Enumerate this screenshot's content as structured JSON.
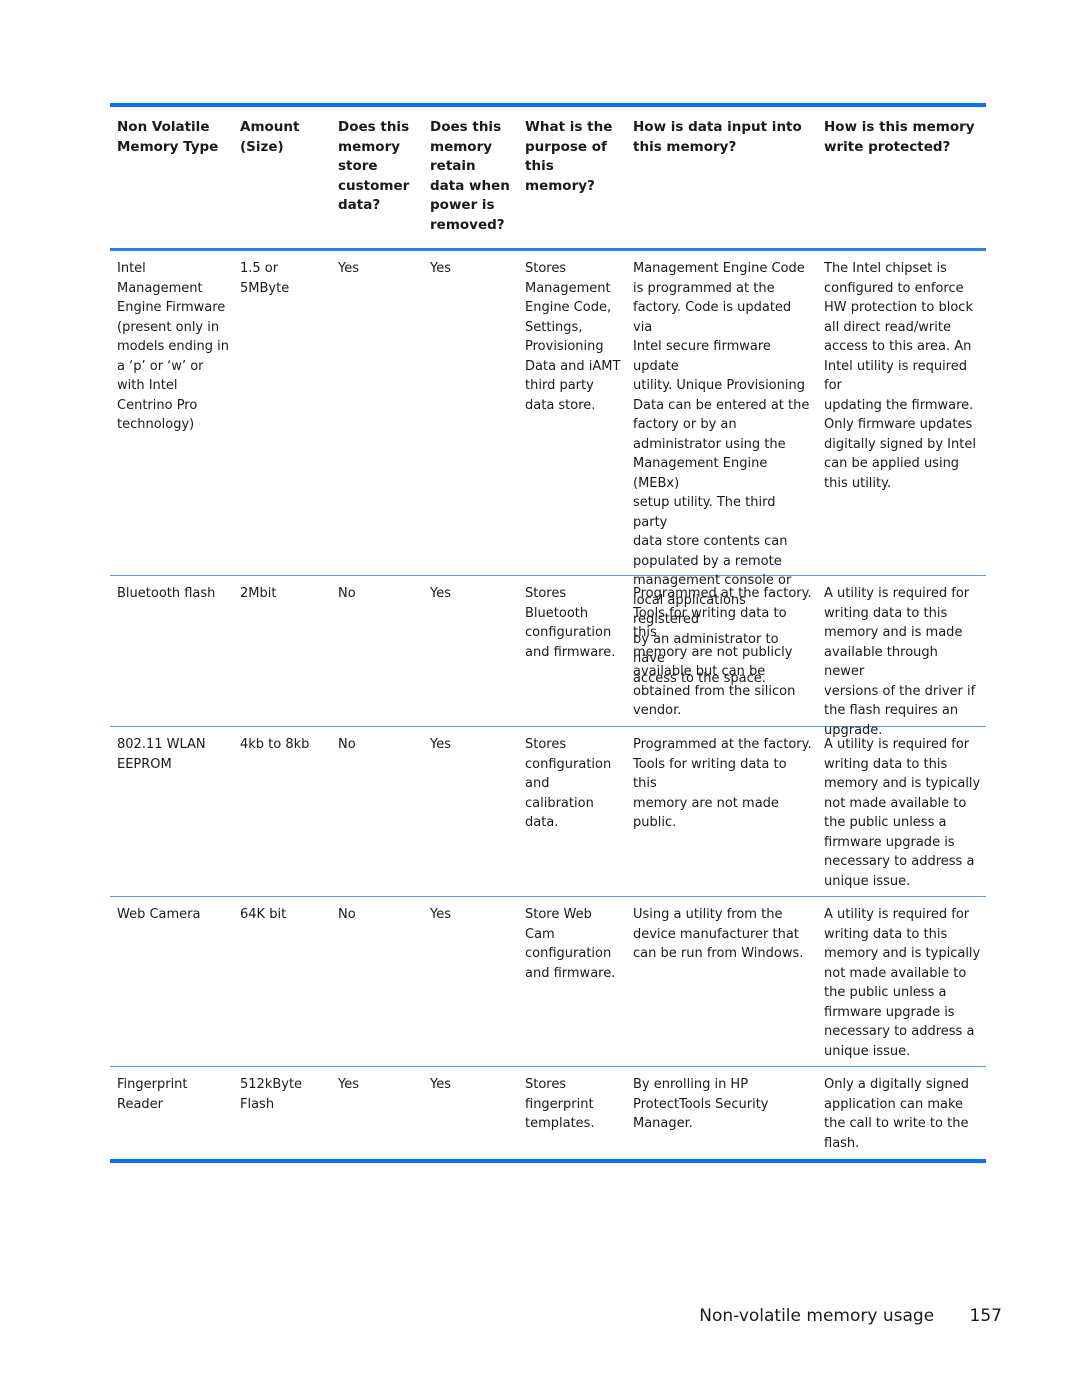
{
  "table": {
    "headers": [
      "Non Volatile\nMemory Type",
      "Amount\n(Size)",
      "Does this\nmemory\nstore\ncustomer\ndata?",
      "Does this\nmemory\nretain\ndata when\npower is\nremoved?",
      "What is the\npurpose of\nthis\nmemory?",
      "How is data input into\nthis memory?",
      "How is this memory\nwrite protected?"
    ],
    "rows": [
      {
        "type": "Intel\nManagement\nEngine Firmware\n(present only in\nmodels ending in\na ‘p’ or ‘w’ or\nwith Intel\nCentrino Pro\ntechnology)",
        "size": "1.5 or\n5MByte",
        "stores_customer_data": "Yes",
        "retains_data": "Yes",
        "purpose": "Stores\nManagement\nEngine Code,\nSettings,\nProvisioning\nData and iAMT\nthird party\ndata store.",
        "data_input": "Management Engine Code\nis programmed at the\nfactory. Code is updated via\nIntel secure firmware update\nutility. Unique Provisioning\nData can be entered at the\nfactory or by an\nadministrator using the\nManagement Engine (MEBx)\nsetup utility. The third party\ndata store contents can\npopulated by a remote\nmanagement console or\nlocal applications registered\nby an administrator to have\naccess to the space.",
        "write_protection": "The Intel chipset is\nconfigured to enforce\nHW protection to block\nall direct read/write\naccess to this area. An\nIntel utility is required for\nupdating the firmware.\nOnly firmware updates\ndigitally signed by Intel\ncan be applied using\nthis utility."
      },
      {
        "type": "Bluetooth flash",
        "size": "2Mbit",
        "stores_customer_data": "No",
        "retains_data": "Yes",
        "purpose": "Stores\nBluetooth\nconfiguration\nand firmware.",
        "data_input": "Programmed at the factory.\nTools for writing data to this\nmemory are not publicly\navailable but can be\nobtained from the silicon\nvendor.",
        "write_protection": "A utility is required for\nwriting data to this\nmemory and is made\navailable through newer\nversions of the driver if\nthe flash requires an\nupgrade."
      },
      {
        "type": "802.11 WLAN\nEEPROM",
        "size": "4kb to 8kb",
        "stores_customer_data": "No",
        "retains_data": "Yes",
        "purpose": "Stores\nconfiguration\nand calibration\ndata.",
        "data_input": "Programmed at the factory.\nTools for writing data to this\nmemory are not made\npublic.",
        "write_protection": "A utility is required for\nwriting data to this\nmemory and is typically\nnot made available to\nthe public unless a\nfirmware upgrade is\nnecessary to address a\nunique issue."
      },
      {
        "type": "Web Camera",
        "size": "64K bit",
        "stores_customer_data": "No",
        "retains_data": "Yes",
        "purpose": "Store Web\nCam\nconfiguration\nand firmware.",
        "data_input": "Using a utility from the\ndevice manufacturer that\ncan be run from Windows.",
        "write_protection": "A utility is required for\nwriting data to this\nmemory and is typically\nnot made available to\nthe public unless a\nfirmware upgrade is\nnecessary to address a\nunique issue."
      },
      {
        "type": "Fingerprint\nReader",
        "size": "512kByte\nFlash",
        "stores_customer_data": "Yes",
        "retains_data": "Yes",
        "purpose": "Stores\nfingerprint\ntemplates.",
        "data_input": "By enrolling in HP\nProtectTools Security\nManager.",
        "write_protection": "Only a digitally signed\napplication can make\nthe call to write to the\nflash."
      }
    ]
  },
  "footer": {
    "section_title": "Non-volatile memory usage",
    "page_number": "157"
  },
  "colors": {
    "rule_accent": "#0a6ff0"
  }
}
